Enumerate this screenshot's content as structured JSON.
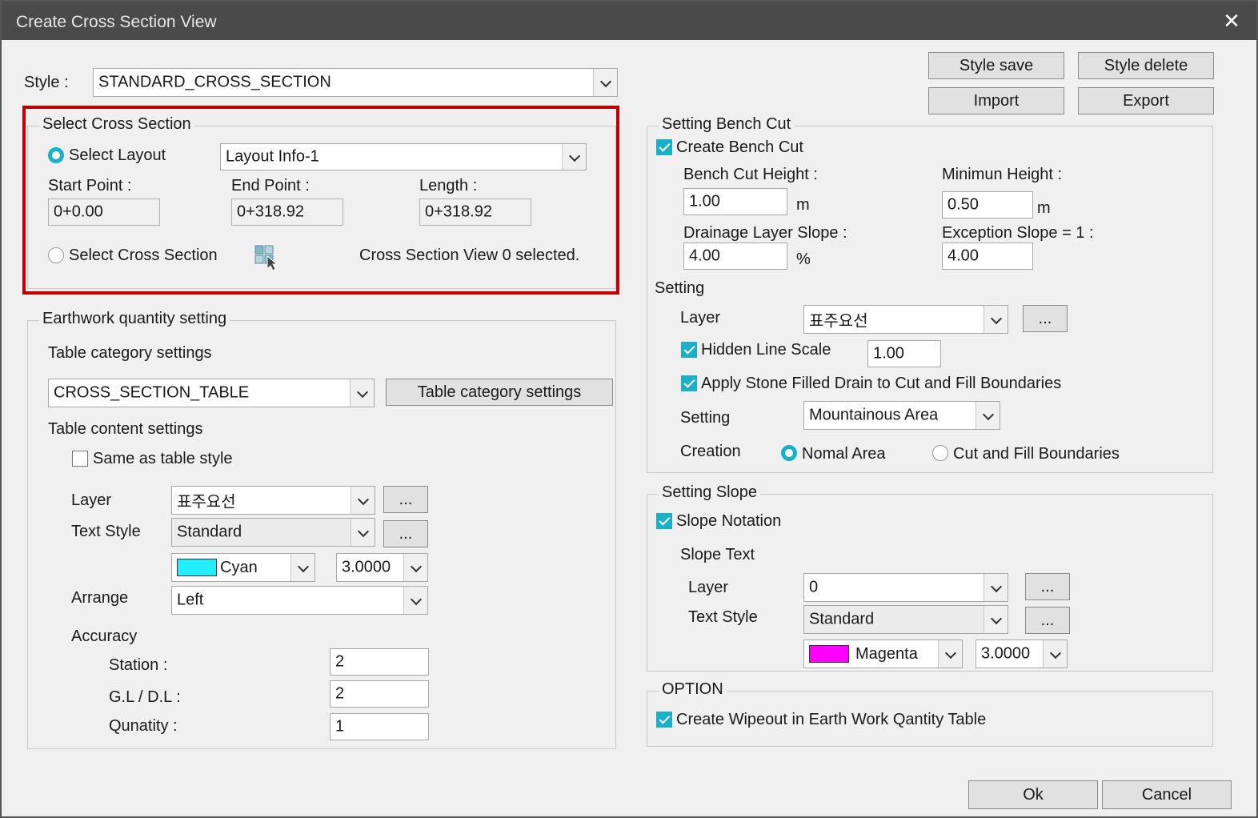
{
  "window": {
    "title": "Create Cross Section View",
    "close_symbol": "✕"
  },
  "style": {
    "label": "Style :",
    "value": "STANDARD_CROSS_SECTION"
  },
  "top_buttons": {
    "style_save": "Style save",
    "style_delete": "Style delete",
    "import": "Import",
    "export": "Export"
  },
  "select_cross_section": {
    "title": "Select Cross Section",
    "select_layout_label": "Select Layout",
    "layout_value": "Layout Info-1",
    "start_point_label": "Start Point :",
    "start_point_value": "0+0.00",
    "end_point_label": "End Point :",
    "end_point_value": "0+318.92",
    "length_label": "Length :",
    "length_value": "0+318.92",
    "select_cross_section_label": "Select Cross Section",
    "status_text": "Cross Section View 0 selected."
  },
  "earthwork": {
    "title": "Earthwork quantity setting",
    "table_category_label": "Table category settings",
    "table_category_value": "CROSS_SECTION_TABLE",
    "table_category_button": "Table category settings",
    "table_content_label": "Table content settings",
    "same_as_table_style": "Same as table style",
    "layer_label": "Layer",
    "layer_value": "표주요선",
    "text_style_label": "Text Style",
    "text_style_value": "Standard",
    "color_value": "Cyan",
    "color_hex": "#22eeff",
    "height_value": "3.0000",
    "arrange_label": "Arrange",
    "arrange_value": "Left",
    "accuracy_label": "Accuracy",
    "station_label": "Station :",
    "station_value": "2",
    "gl_dl_label": "G.L / D.L :",
    "gl_dl_value": "2",
    "quantity_label": "Qunatity :",
    "quantity_value": "1",
    "ellipsis": "..."
  },
  "bench_cut": {
    "title": "Setting Bench Cut",
    "create_label": "Create Bench Cut",
    "height_label": "Bench Cut Height :",
    "height_value": "1.00",
    "height_unit": "m",
    "min_height_label": "Minimun Height :",
    "min_height_value": "0.50",
    "min_height_unit": "m",
    "drainage_label": "Drainage Layer Slope :",
    "drainage_value": "4.00",
    "drainage_unit": "%",
    "exception_label": "Exception Slope = 1 :",
    "exception_value": "4.00",
    "setting_label": "Setting",
    "layer_label": "Layer",
    "layer_value": "표주요선",
    "hidden_line_label": "Hidden Line Scale",
    "hidden_line_value": "1.00",
    "apply_stone_label": "Apply Stone Filled Drain to Cut and Fill Boundaries",
    "setting2_label": "Setting",
    "setting2_value": "Mountainous Area",
    "creation_label": "Creation",
    "normal_area_label": "Nomal Area",
    "cut_fill_label": "Cut and Fill Boundaries",
    "ellipsis": "..."
  },
  "slope": {
    "title": "Setting Slope",
    "notation_label": "Slope Notation",
    "slope_text_label": "Slope Text",
    "layer_label": "Layer",
    "layer_value": "0",
    "text_style_label": "Text Style",
    "text_style_value": "Standard",
    "color_value": "Magenta",
    "color_hex": "#ff00ff",
    "height_value": "3.0000",
    "ellipsis": "..."
  },
  "option": {
    "title": "OPTION",
    "wipeout_label": "Create Wipeout in Earth Work Qantity Table"
  },
  "footer": {
    "ok": "Ok",
    "cancel": "Cancel"
  },
  "colors": {
    "highlight": "#c00000",
    "accent": "#1ab0c8",
    "titlebar": "#4a4a4a"
  }
}
